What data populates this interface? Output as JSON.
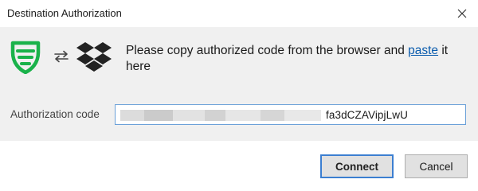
{
  "window": {
    "title": "Destination Authorization"
  },
  "icons": {
    "app": "shield-logo-icon",
    "transfer": "swap-arrows-icon",
    "service": "dropbox-icon",
    "close": "close-icon"
  },
  "message": {
    "text_before": "Please copy authorized code from the browser and ",
    "link": "paste",
    "text_after": " it here"
  },
  "authorization": {
    "label": "Authorization code",
    "value": "fa3dCZAVipjLwU"
  },
  "buttons": {
    "connect": "Connect",
    "cancel": "Cancel"
  },
  "colors": {
    "brand_green": "#1ab24a",
    "link_blue": "#0b5cad",
    "focus_blue": "#3c7fd1",
    "panel_bg": "#f0f0f0"
  }
}
